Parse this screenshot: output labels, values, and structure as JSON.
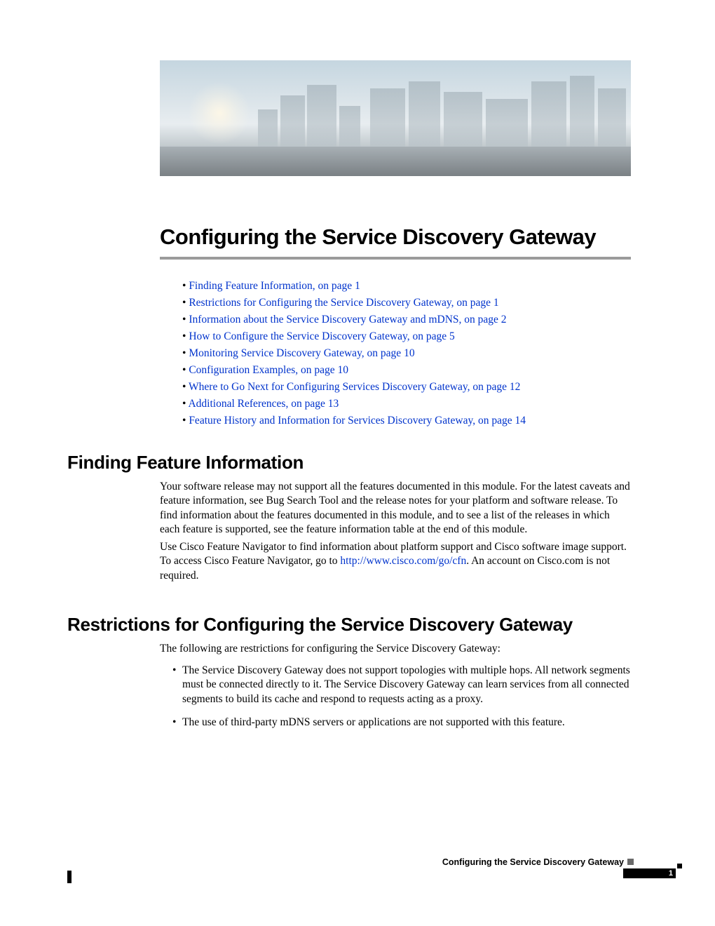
{
  "title": "Configuring the Service Discovery Gateway",
  "toc": [
    "Finding Feature Information, on page 1",
    "Restrictions for Configuring the Service Discovery Gateway, on page 1",
    "Information about the Service Discovery Gateway and mDNS, on page 2",
    "How to Configure the Service Discovery Gateway, on page 5",
    "Monitoring Service Discovery Gateway, on page 10",
    "Configuration Examples, on page 10",
    "Where to Go Next for Configuring Services Discovery Gateway, on page 12",
    "Additional References, on page 13",
    "Feature History and Information for Services Discovery Gateway, on page 14"
  ],
  "sections": {
    "finding": {
      "heading": "Finding Feature Information",
      "p1": "Your software release may not support all the features documented in this module. For the latest caveats and feature information, see Bug Search Tool and the release notes for your platform and software release. To find information about the features documented in this module, and to see a list of the releases in which each feature is supported, see the feature information table at the end of this module.",
      "p2a": "Use Cisco Feature Navigator to find information about platform support and Cisco software image support. To access Cisco Feature Navigator, go to ",
      "p2_link": "http://www.cisco.com/go/cfn",
      "p2b": ". An account on Cisco.com is not required."
    },
    "restrictions": {
      "heading": "Restrictions for Configuring the Service Discovery Gateway",
      "intro": "The following are restrictions for configuring the Service Discovery Gateway:",
      "items": [
        "The Service Discovery Gateway does not support topologies with multiple hops. All network segments must be connected directly to it. The Service Discovery Gateway can learn services from all connected segments to build its cache and respond to requests acting as a proxy.",
        "The use of third-party mDNS servers or applications are not supported with this feature."
      ]
    }
  },
  "footer": {
    "title": "Configuring the Service Discovery Gateway",
    "page": "1"
  }
}
